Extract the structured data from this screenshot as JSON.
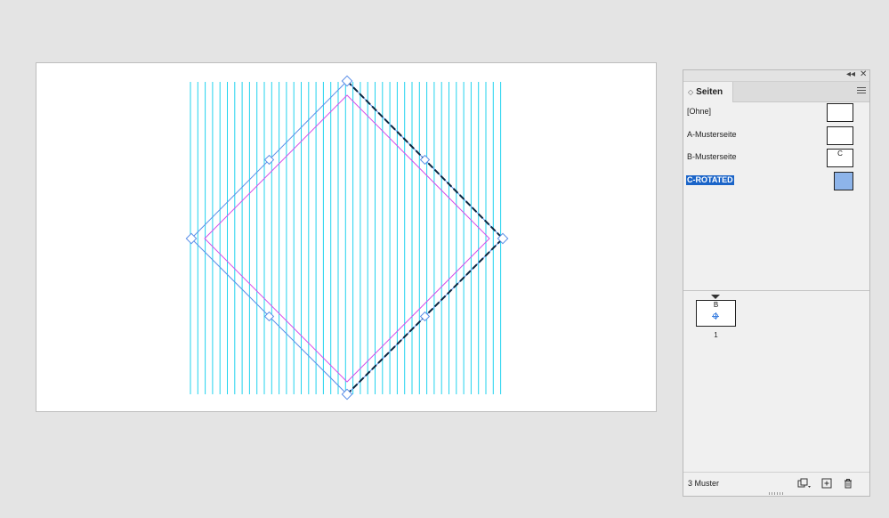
{
  "panel": {
    "tab_label": "Seiten",
    "collapse_glyph": "◂◂",
    "close_glyph": "✕",
    "masters": [
      {
        "label": "[Ohne]",
        "thumb_letter": ""
      },
      {
        "label": "A-Musterseite",
        "thumb_letter": ""
      },
      {
        "label": "B-Musterseite",
        "thumb_letter": "C"
      },
      {
        "label": "C-ROTATED",
        "thumb_letter": ""
      }
    ],
    "page": {
      "master_letter": "B",
      "number": "1"
    },
    "footer": {
      "count_text": "3 Muster"
    }
  },
  "colors": {
    "guide": "#22d3ee",
    "margin": "#d64ce8",
    "frame": "#5a8ee8",
    "selection": "#1a64c8",
    "master_thumb_fill": "#8db4ea"
  },
  "icons": {
    "tab_sort": "sort-arrows-icon",
    "menu": "hamburger-menu-icon",
    "page_size": "page-size-icon",
    "new_page": "new-page-icon",
    "delete": "trash-icon"
  }
}
